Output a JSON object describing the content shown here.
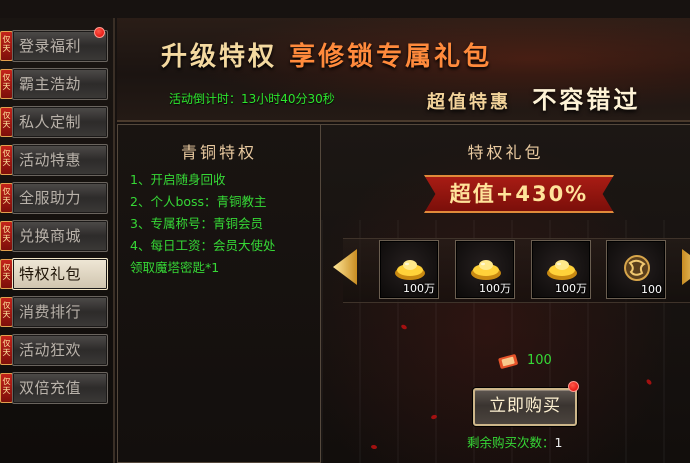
{
  "sidebar": {
    "tag_text": "仅天",
    "items": [
      {
        "label": "登录福利",
        "active": false,
        "dot": true
      },
      {
        "label": "霸主浩劫",
        "active": false,
        "dot": false
      },
      {
        "label": "私人定制",
        "active": false,
        "dot": false
      },
      {
        "label": "活动特惠",
        "active": false,
        "dot": false
      },
      {
        "label": "全服助力",
        "active": false,
        "dot": false
      },
      {
        "label": "兑换商城",
        "active": false,
        "dot": false
      },
      {
        "label": "特权礼包",
        "active": true,
        "dot": false
      },
      {
        "label": "消费排行",
        "active": false,
        "dot": false
      },
      {
        "label": "活动狂欢",
        "active": false,
        "dot": false
      },
      {
        "label": "双倍充值",
        "active": false,
        "dot": false
      }
    ]
  },
  "header": {
    "title_prefix": "升级特权",
    "title_highlight": "享修锁专属礼包",
    "countdown": "活动倒计时：13小时40分30秒",
    "slogan_small": "超值特惠",
    "slogan_big": "不容错过"
  },
  "privileges": {
    "title": "青铜特权",
    "lines": [
      "1、开启随身回收",
      "2、个人boss：青铜教主",
      "3、专属称号：青铜会员",
      "4、每日工资：会员大使处",
      "领取魔塔密匙*1"
    ]
  },
  "gift": {
    "title": "特权礼包",
    "ribbon": "超值+430%",
    "items": [
      {
        "icon": "gold-ingot-icon",
        "count": "100万"
      },
      {
        "icon": "gold-ingot-icon",
        "count": "100万"
      },
      {
        "icon": "gold-ingot-icon",
        "count": "100万"
      },
      {
        "icon": "rune-medallion-icon",
        "count": "100"
      }
    ],
    "price_icon": "currency-ticket-icon",
    "price": "100",
    "buy_label": "立即购买",
    "remaining_label": "剩余购买次数：",
    "remaining_value": "1"
  },
  "colors": {
    "accent_green": "#36d836",
    "ribbon_red": "#a81c14",
    "gold": "#ffe39a"
  }
}
